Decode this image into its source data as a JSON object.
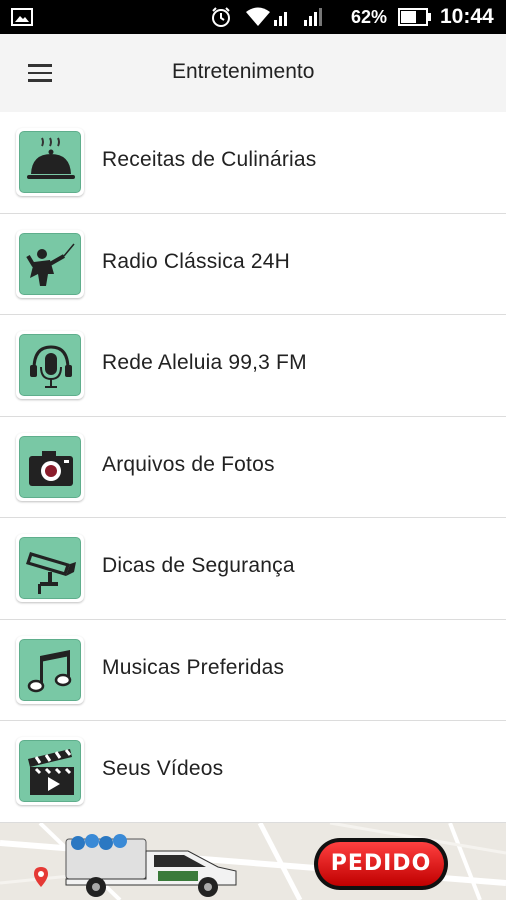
{
  "status_bar": {
    "battery_percent": "62%",
    "time": "10:44",
    "icons": [
      "gallery-icon",
      "alarm-icon",
      "wifi-icon",
      "signal-icon",
      "battery-icon"
    ]
  },
  "app_bar": {
    "title": "Entretenimento",
    "menu_icon": "menu-icon"
  },
  "menu_items": [
    {
      "label": "Receitas de Culinárias",
      "icon": "cloche-icon"
    },
    {
      "label": "Radio Clássica 24H",
      "icon": "conductor-icon"
    },
    {
      "label": "Rede Aleluia 99,3 FM",
      "icon": "microphone-headphones-icon"
    },
    {
      "label": "Arquivos de Fotos",
      "icon": "camera-icon"
    },
    {
      "label": "Dicas de Segurança",
      "icon": "security-camera-icon"
    },
    {
      "label": "Musicas Preferidas",
      "icon": "music-note-icon"
    },
    {
      "label": "Seus Vídeos",
      "icon": "clapperboard-icon"
    }
  ],
  "ad_banner": {
    "button_label": "PEDIDO"
  },
  "colors": {
    "icon_background": "#79c8a5",
    "icon_foreground": "#1e1e1e",
    "app_bar_background": "#f4f4f4",
    "status_bar_background": "#000000",
    "ad_button_red": "#e00000"
  }
}
